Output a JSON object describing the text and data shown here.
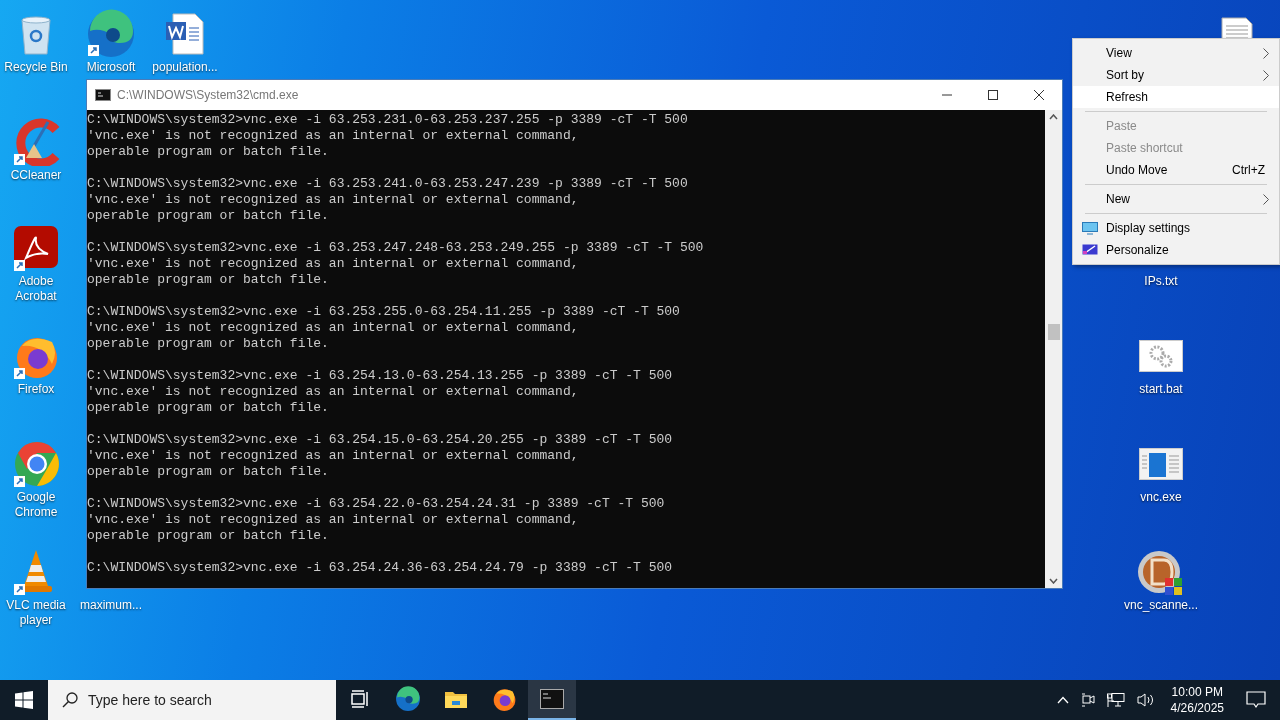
{
  "desktop_icons": [
    {
      "label": "Recycle Bin",
      "kind": "recycle"
    },
    {
      "label": "Microsoft",
      "kind": "edge"
    },
    {
      "label": "population...",
      "kind": "word"
    },
    {
      "label": "CCleaner",
      "kind": "ccleaner"
    },
    {
      "label": "Adobe Acrobat",
      "kind": "acrobat"
    },
    {
      "label": "Firefox",
      "kind": "firefox"
    },
    {
      "label": "Google Chrome",
      "kind": "chrome"
    },
    {
      "label": "VLC media player",
      "kind": "vlc"
    },
    {
      "label": "maximum...",
      "kind": "label_only"
    },
    {
      "label": "IPs.txt",
      "kind": "label_only"
    },
    {
      "label": "start.bat",
      "kind": "batch"
    },
    {
      "label": "vnc.exe",
      "kind": "exe"
    },
    {
      "label": "vnc_scanne...",
      "kind": "scanner"
    },
    {
      "kind": "textfile"
    }
  ],
  "cmd_window": {
    "title": "C:\\WINDOWS\\System32\\cmd.exe",
    "blocks": [
      {
        "command": "C:\\WINDOWS\\system32>vnc.exe -i 63.253.231.0-63.253.237.255 -p 3389 -cT -T 500",
        "output": [
          "'vnc.exe' is not recognized as an internal or external command,",
          "operable program or batch file."
        ]
      },
      {
        "command": "C:\\WINDOWS\\system32>vnc.exe -i 63.253.241.0-63.253.247.239 -p 3389 -cT -T 500",
        "output": [
          "'vnc.exe' is not recognized as an internal or external command,",
          "operable program or batch file."
        ]
      },
      {
        "command": "C:\\WINDOWS\\system32>vnc.exe -i 63.253.247.248-63.253.249.255 -p 3389 -cT -T 500",
        "output": [
          "'vnc.exe' is not recognized as an internal or external command,",
          "operable program or batch file."
        ]
      },
      {
        "command": "C:\\WINDOWS\\system32>vnc.exe -i 63.253.255.0-63.254.11.255 -p 3389 -cT -T 500",
        "output": [
          "'vnc.exe' is not recognized as an internal or external command,",
          "operable program or batch file."
        ]
      },
      {
        "command": "C:\\WINDOWS\\system32>vnc.exe -i 63.254.13.0-63.254.13.255 -p 3389 -cT -T 500",
        "output": [
          "'vnc.exe' is not recognized as an internal or external command,",
          "operable program or batch file."
        ]
      },
      {
        "command": "C:\\WINDOWS\\system32>vnc.exe -i 63.254.15.0-63.254.20.255 -p 3389 -cT -T 500",
        "output": [
          "'vnc.exe' is not recognized as an internal or external command,",
          "operable program or batch file."
        ]
      },
      {
        "command": "C:\\WINDOWS\\system32>vnc.exe -i 63.254.22.0-63.254.24.31 -p 3389 -cT -T 500",
        "output": [
          "'vnc.exe' is not recognized as an internal or external command,",
          "operable program or batch file."
        ]
      },
      {
        "command": "C:\\WINDOWS\\system32>vnc.exe -i 63.254.24.36-63.254.24.79 -p 3389 -cT -T 500"
      }
    ]
  },
  "context_menu": {
    "items": [
      {
        "kind": "item",
        "label": "View",
        "submenu": true,
        "disabled": false,
        "selected": false
      },
      {
        "kind": "item",
        "label": "Sort by",
        "submenu": true,
        "disabled": false,
        "selected": false
      },
      {
        "kind": "item",
        "label": "Refresh",
        "submenu": false,
        "disabled": false,
        "selected": true
      },
      {
        "kind": "separator"
      },
      {
        "kind": "item",
        "label": "Paste",
        "submenu": false,
        "disabled": true,
        "selected": false
      },
      {
        "kind": "item",
        "label": "Paste shortcut",
        "submenu": false,
        "disabled": true,
        "selected": false
      },
      {
        "kind": "item",
        "label": "Undo Move",
        "shortcut": "Ctrl+Z",
        "submenu": false,
        "disabled": false,
        "selected": false
      },
      {
        "kind": "separator"
      },
      {
        "kind": "item",
        "label": "New",
        "submenu": true,
        "disabled": false,
        "selected": false
      },
      {
        "kind": "separator"
      },
      {
        "kind": "display",
        "label": "Display settings",
        "submenu": false,
        "disabled": false,
        "selected": false
      },
      {
        "kind": "personalize",
        "label": "Personalize",
        "submenu": false,
        "disabled": false,
        "selected": false
      }
    ]
  },
  "taskbar": {
    "search_placeholder": "Type here to search",
    "apps": [
      {
        "kind": "taskview",
        "active": false
      },
      {
        "kind": "edge",
        "active": false
      },
      {
        "kind": "explorer",
        "active": false
      },
      {
        "kind": "firefox",
        "active": false
      },
      {
        "kind": "cmd",
        "active": true
      }
    ],
    "time": "10:00 PM",
    "date": "4/26/2025"
  }
}
